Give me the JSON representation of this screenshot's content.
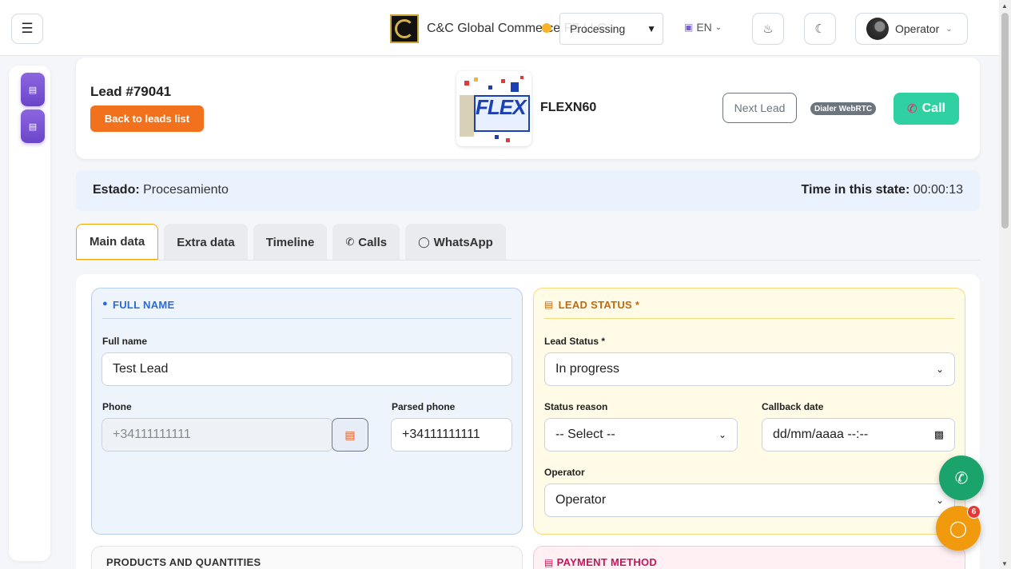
{
  "topbar": {
    "company_name": "C&C Global Commerce FZ LLC",
    "status_select": "Processing",
    "language": "EN",
    "user_name": "Operator"
  },
  "lead": {
    "title": "Lead #79041",
    "back_label": "Back to leads list",
    "product_name": "FLEXN60",
    "product_logo_text": "FLEX",
    "next_label": "Next Lead",
    "dialer_label": "Dialer WebRTC",
    "call_label": "Call"
  },
  "state": {
    "label": "Estado:",
    "value": "Procesamiento",
    "time_label": "Time in this state:",
    "time_value": "00:00:13"
  },
  "tabs": [
    {
      "label": "Main data"
    },
    {
      "label": "Extra data"
    },
    {
      "label": "Timeline"
    },
    {
      "label": "Calls"
    },
    {
      "label": "WhatsApp"
    }
  ],
  "full_name_panel": {
    "title": "FULL NAME",
    "full_name_label": "Full name",
    "full_name_value": "Test Lead",
    "phone_label": "Phone",
    "phone_value": "+34111111111",
    "parsed_phone_label": "Parsed phone",
    "parsed_phone_value": "+34111111111"
  },
  "lead_status_panel": {
    "title": "LEAD STATUS *",
    "status_label": "Lead Status *",
    "status_value": "In progress",
    "reason_label": "Status reason",
    "reason_value": "-- Select --",
    "callback_label": "Callback date",
    "callback_value": "dd/mm/aaaa --:--",
    "operator_label": "Operator",
    "operator_value": "Operator"
  },
  "bottom_panels": {
    "products_title": "PRODUCTS AND QUANTITIES",
    "payment_title": "PAYMENT METHOD"
  },
  "chat_badge_count": "6",
  "colors": {
    "accent_purple": "#6a45c9",
    "back_orange": "#f2711c",
    "call_green": "#2fd1a3",
    "fab_green": "#1aa36b",
    "fab_orange": "#f29a0e"
  }
}
